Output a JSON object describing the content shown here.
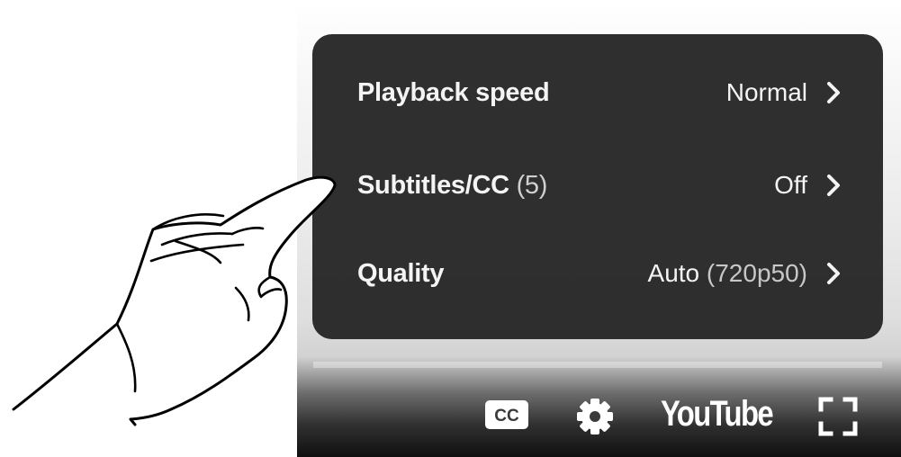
{
  "settings_menu": {
    "items": [
      {
        "label": "Playback speed",
        "count": "",
        "value": "Normal",
        "value_detail": ""
      },
      {
        "label": "Subtitles/CC",
        "count": "(5)",
        "value": "Off",
        "value_detail": ""
      },
      {
        "label": "Quality",
        "count": "",
        "value": "Auto",
        "value_detail": "(720p50)"
      }
    ]
  },
  "controls": {
    "cc_label": "CC",
    "logo_text": "YouTube"
  },
  "colors": {
    "menu_background": "#282828",
    "menu_text": "#f4f4f4",
    "secondary_text": "#c8c8c8",
    "control_icon": "#ffffff"
  },
  "icons": [
    "chevron-right-icon",
    "cc-icon",
    "gear-icon",
    "fullscreen-icon",
    "pointing-hand"
  ]
}
